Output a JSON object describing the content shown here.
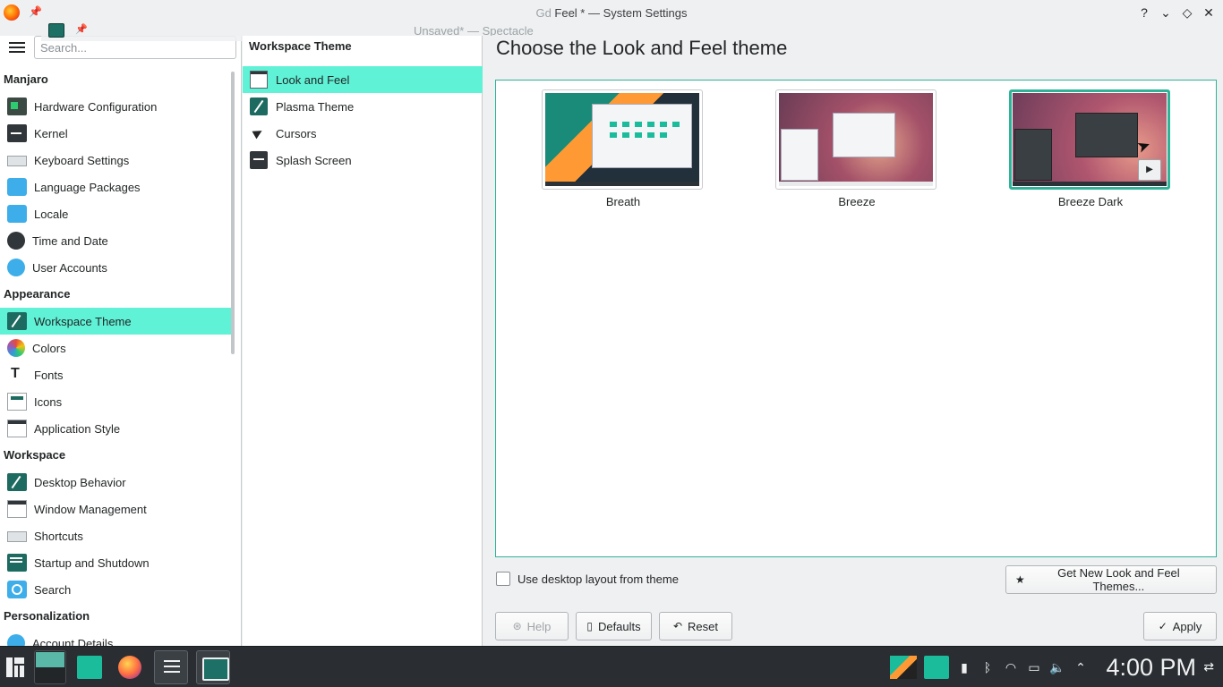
{
  "window": {
    "title_prefix": "Gd",
    "title_main": " Feel * — System Settings"
  },
  "overlay": {
    "title": "Unsaved* — Spectacle"
  },
  "sidebar": {
    "search_placeholder": "Search...",
    "sections": [
      {
        "header": "Manjaro",
        "items": [
          "Hardware Configuration",
          "Kernel",
          "Keyboard Settings",
          "Language Packages",
          "Locale",
          "Time and Date",
          "User Accounts"
        ]
      },
      {
        "header": "Appearance",
        "items": [
          "Workspace Theme",
          "Colors",
          "Fonts",
          "Icons",
          "Application Style"
        ]
      },
      {
        "header": "Workspace",
        "items": [
          "Desktop Behavior",
          "Window Management",
          "Shortcuts",
          "Startup and Shutdown",
          "Search"
        ]
      },
      {
        "header": "Personalization",
        "items": [
          "Account Details"
        ]
      }
    ]
  },
  "middle": {
    "title": "Workspace Theme",
    "items": [
      "Look and Feel",
      "Plasma Theme",
      "Cursors",
      "Splash Screen"
    ]
  },
  "content": {
    "heading": "Choose the Look and Feel theme",
    "themes": [
      {
        "label": "Breath",
        "selected": false
      },
      {
        "label": "Breeze",
        "selected": false
      },
      {
        "label": "Breeze Dark",
        "selected": true
      }
    ],
    "use_layout_label": "Use desktop layout from theme",
    "get_new_label": "Get New Look and Feel Themes...",
    "help_label": "Help",
    "defaults_label": "Defaults",
    "reset_label": "Reset",
    "apply_label": "Apply"
  },
  "taskbar": {
    "clock": "4:00 PM"
  },
  "colors": {
    "accent": "#5ff2d6",
    "accent_border": "#2eb398",
    "panel": "#2a2e32"
  }
}
